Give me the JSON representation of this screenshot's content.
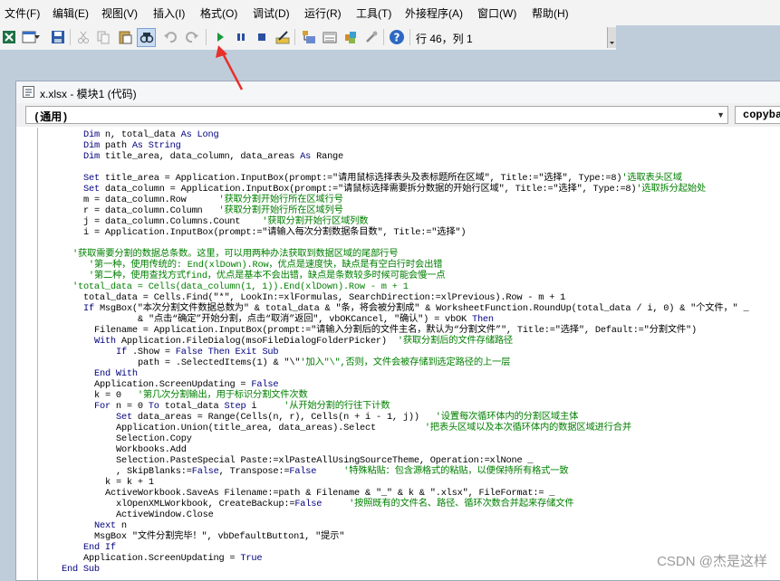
{
  "menubar": {
    "items": [
      "文件(F)",
      "编辑(E)",
      "视图(V)",
      "插入(I)",
      "格式(O)",
      "调试(D)",
      "运行(R)",
      "工具(T)",
      "外接程序(A)",
      "窗口(W)",
      "帮助(H)"
    ]
  },
  "toolbar": {
    "cursor_position": "行 46，列 1"
  },
  "code_window": {
    "title": "x.xlsx - 模块1 (代码)",
    "object_combo": "(通用)",
    "procedure_combo": "copyba"
  },
  "code_lines": [
    {
      "indent": 8,
      "parts": [
        {
          "k": "kw",
          "t": "Dim"
        },
        {
          "k": "tx",
          "t": " n, total_data "
        },
        {
          "k": "kw",
          "t": "As Long"
        }
      ]
    },
    {
      "indent": 8,
      "parts": [
        {
          "k": "kw",
          "t": "Dim"
        },
        {
          "k": "tx",
          "t": " path "
        },
        {
          "k": "kw",
          "t": "As String"
        }
      ]
    },
    {
      "indent": 8,
      "parts": [
        {
          "k": "kw",
          "t": "Dim"
        },
        {
          "k": "tx",
          "t": " title_area, data_column, data_areas "
        },
        {
          "k": "kw",
          "t": "As"
        },
        {
          "k": "tx",
          "t": " Range"
        }
      ]
    },
    {
      "indent": 0,
      "parts": []
    },
    {
      "indent": 8,
      "parts": [
        {
          "k": "kw",
          "t": "Set"
        },
        {
          "k": "tx",
          "t": " title_area = Application.InputBox(prompt:=\"请用鼠标选择表头及表标题所在区域\", Title:=\"选择\", Type:=8)"
        },
        {
          "k": "cm",
          "t": "'选取表头区域"
        }
      ]
    },
    {
      "indent": 8,
      "parts": [
        {
          "k": "kw",
          "t": "Set"
        },
        {
          "k": "tx",
          "t": " data_column = Application.InputBox(prompt:=\"请鼠标选择需要拆分数据的开始行区域\", Title:=\"选择\", Type:=8)"
        },
        {
          "k": "cm",
          "t": "'选取拆分起始处"
        }
      ]
    },
    {
      "indent": 8,
      "parts": [
        {
          "k": "tx",
          "t": "m = data_column.Row      "
        },
        {
          "k": "cm",
          "t": "'获取分割开始行所在区域行号"
        }
      ]
    },
    {
      "indent": 8,
      "parts": [
        {
          "k": "tx",
          "t": "r = data_column.Column   "
        },
        {
          "k": "cm",
          "t": "'获取分割开始行所在区域列号"
        }
      ]
    },
    {
      "indent": 8,
      "parts": [
        {
          "k": "tx",
          "t": "j = data_column.Columns.Count    "
        },
        {
          "k": "cm",
          "t": "'获取分割开始行区域列数"
        }
      ]
    },
    {
      "indent": 8,
      "parts": [
        {
          "k": "tx",
          "t": "i = Application.InputBox(prompt:=\"请输入每次分割数据条目数\", Title:=\"选择\")"
        }
      ]
    },
    {
      "indent": 0,
      "parts": []
    },
    {
      "indent": 6,
      "parts": [
        {
          "k": "cm",
          "t": "'获取需要分割的数据总条数。这里，可以用两种办法获取到数据区域的尾部行号"
        }
      ]
    },
    {
      "indent": 6,
      "parts": [
        {
          "k": "cm",
          "t": "   '第一种，使用传统的: End(xlDown).Row，优点是速度快，缺点是有空白行时会出错"
        }
      ]
    },
    {
      "indent": 6,
      "parts": [
        {
          "k": "cm",
          "t": "   '第二种，使用查找方式find，优点是基本不会出错，缺点是条数较多时候可能会慢一点"
        }
      ]
    },
    {
      "indent": 6,
      "parts": [
        {
          "k": "cm",
          "t": "'total_data = Cells(data_column(1, 1)).End(xlDown).Row - m + 1"
        }
      ]
    },
    {
      "indent": 8,
      "parts": [
        {
          "k": "tx",
          "t": "total_data = Cells.Find(\"*\", LookIn:=xlFormulas, SearchDirection:=xlPrevious).Row - m + 1"
        }
      ]
    },
    {
      "indent": 8,
      "parts": [
        {
          "k": "kw",
          "t": "If"
        },
        {
          "k": "tx",
          "t": " MsgBox(\"本次分割文件数据总数为\" & total_data & \"条，将会被分割成\" & WorksheetFunction.RoundUp(total_data / i, 0) & \"个文件，\" _"
        }
      ]
    },
    {
      "indent": 18,
      "parts": [
        {
          "k": "tx",
          "t": "& \"点击“确定”开始分割，点击“取消”返回\", vbOKCancel, \"确认\") = vbOK "
        },
        {
          "k": "kw",
          "t": "Then"
        }
      ]
    },
    {
      "indent": 10,
      "parts": [
        {
          "k": "tx",
          "t": "Filename = Application.InputBox(prompt:=\"请输入分割后的文件主名，默认为“分割文件”\", Title:=\"选择\", Default:=\"分割文件\")"
        }
      ]
    },
    {
      "indent": 10,
      "parts": [
        {
          "k": "kw",
          "t": "With"
        },
        {
          "k": "tx",
          "t": " Application.FileDialog(msoFileDialogFolderPicker)  "
        },
        {
          "k": "cm",
          "t": "'获取分割后的文件存储路径"
        }
      ]
    },
    {
      "indent": 14,
      "parts": [
        {
          "k": "kw",
          "t": "If"
        },
        {
          "k": "tx",
          "t": " .Show = "
        },
        {
          "k": "kw",
          "t": "False Then Exit Sub"
        }
      ]
    },
    {
      "indent": 18,
      "parts": [
        {
          "k": "tx",
          "t": "path = .SelectedItems(1) & \"\\\""
        },
        {
          "k": "cm",
          "t": "'加入\"\\\",否则，文件会被存储到选定路径的上一层"
        }
      ]
    },
    {
      "indent": 10,
      "parts": [
        {
          "k": "kw",
          "t": "End With"
        }
      ]
    },
    {
      "indent": 10,
      "parts": [
        {
          "k": "tx",
          "t": "Application.ScreenUpdating = "
        },
        {
          "k": "kw",
          "t": "False"
        }
      ]
    },
    {
      "indent": 10,
      "parts": [
        {
          "k": "tx",
          "t": "k = 0   "
        },
        {
          "k": "cm",
          "t": "'第几次分割输出，用于标识分割文件次数"
        }
      ]
    },
    {
      "indent": 10,
      "parts": [
        {
          "k": "kw",
          "t": "For"
        },
        {
          "k": "tx",
          "t": " n = 0 "
        },
        {
          "k": "kw",
          "t": "To"
        },
        {
          "k": "tx",
          "t": " total_data "
        },
        {
          "k": "kw",
          "t": "Step"
        },
        {
          "k": "tx",
          "t": " i     "
        },
        {
          "k": "cm",
          "t": "'从开始分割的行往下计数"
        }
      ]
    },
    {
      "indent": 14,
      "parts": [
        {
          "k": "kw",
          "t": "Set"
        },
        {
          "k": "tx",
          "t": " data_areas = Range(Cells(n, r), Cells(n + i - 1, j))   "
        },
        {
          "k": "cm",
          "t": "'设置每次循环体内的分割区域主体"
        }
      ]
    },
    {
      "indent": 14,
      "parts": [
        {
          "k": "tx",
          "t": "Application.Union(title_area, data_areas).Select         "
        },
        {
          "k": "cm",
          "t": "'把表头区域以及本次循环体内的数据区域进行合并"
        }
      ]
    },
    {
      "indent": 14,
      "parts": [
        {
          "k": "tx",
          "t": "Selection.Copy"
        }
      ]
    },
    {
      "indent": 14,
      "parts": [
        {
          "k": "tx",
          "t": "Workbooks.Add"
        }
      ]
    },
    {
      "indent": 14,
      "parts": [
        {
          "k": "tx",
          "t": "Selection.PasteSpecial Paste:=xlPasteAllUsingSourceTheme, Operation:=xlNone _"
        }
      ]
    },
    {
      "indent": 14,
      "parts": [
        {
          "k": "tx",
          "t": ", SkipBlanks:="
        },
        {
          "k": "kw",
          "t": "False"
        },
        {
          "k": "tx",
          "t": ", Transpose:="
        },
        {
          "k": "kw",
          "t": "False"
        },
        {
          "k": "tx",
          "t": "     "
        },
        {
          "k": "cm",
          "t": "'特殊粘贴：包含源格式的粘贴，以便保持所有格式一致"
        }
      ]
    },
    {
      "indent": 12,
      "parts": [
        {
          "k": "tx",
          "t": "k = k + 1"
        }
      ]
    },
    {
      "indent": 12,
      "parts": [
        {
          "k": "tx",
          "t": "ActiveWorkbook.SaveAs Filename:=path & Filename & \"_\" & k & \".xlsx\", FileFormat:= _"
        }
      ]
    },
    {
      "indent": 14,
      "parts": [
        {
          "k": "tx",
          "t": "xlOpenXMLWorkbook, CreateBackup:="
        },
        {
          "k": "kw",
          "t": "False"
        },
        {
          "k": "tx",
          "t": "     "
        },
        {
          "k": "cm",
          "t": "'按照既有的文件名、路径、循环次数合并起来存储文件"
        }
      ]
    },
    {
      "indent": 14,
      "parts": [
        {
          "k": "tx",
          "t": "ActiveWindow.Close"
        }
      ]
    },
    {
      "indent": 10,
      "parts": [
        {
          "k": "kw",
          "t": "Next"
        },
        {
          "k": "tx",
          "t": " n"
        }
      ]
    },
    {
      "indent": 10,
      "parts": [
        {
          "k": "tx",
          "t": "MsgBox \"文件分割完毕！\", vbDefaultButton1, \"提示\""
        }
      ]
    },
    {
      "indent": 8,
      "parts": [
        {
          "k": "kw",
          "t": "End If"
        }
      ]
    },
    {
      "indent": 8,
      "parts": [
        {
          "k": "tx",
          "t": "Application.ScreenUpdating = "
        },
        {
          "k": "kw",
          "t": "True"
        }
      ]
    },
    {
      "indent": 4,
      "parts": [
        {
          "k": "kw",
          "t": "End Sub"
        }
      ]
    }
  ],
  "watermark": "CSDN @杰是这样",
  "colors": {
    "keyword": "#00007f",
    "comment": "#007f00",
    "annotation_arrow": "#e8302a",
    "run_button": "#1a9a3a"
  }
}
